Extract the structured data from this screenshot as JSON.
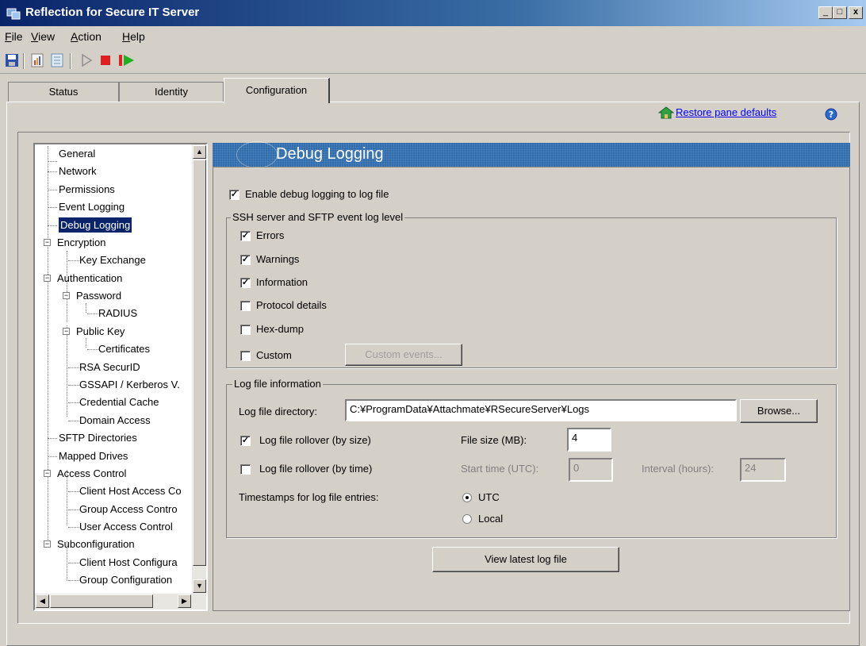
{
  "window": {
    "title": "Reflection for Secure IT Server",
    "controls": [
      "_",
      "□",
      "x"
    ]
  },
  "menu": [
    {
      "label": "File",
      "hotkey": "F",
      "rest": "ile"
    },
    {
      "label": "View",
      "hotkey": "V",
      "rest": "iew"
    },
    {
      "label": "Action",
      "hotkey": "A",
      "rest": "ction"
    },
    {
      "label": "Help",
      "hotkey": "H",
      "rest": "elp"
    }
  ],
  "toolbar": {
    "icons": [
      "save-icon",
      "report-icon",
      "list-icon",
      "start-icon",
      "stop-icon",
      "restart-icon"
    ]
  },
  "tabs": [
    {
      "label": "Status"
    },
    {
      "label": "Identity"
    },
    {
      "label": "Configuration"
    }
  ],
  "restore_link": "Restore pane defaults",
  "tree": {
    "items": [
      "General",
      "Network",
      "Permissions",
      "Event Logging",
      "Debug Logging",
      "Encryption",
      "Key Exchange",
      "Authentication",
      "Password",
      "RADIUS",
      "Public Key",
      "Certificates",
      "RSA SecurID",
      "GSSAPI / Kerberos V.",
      "Credential Cache",
      "Domain Access",
      "SFTP Directories",
      "Mapped Drives",
      "Access Control",
      "Client Host Access Co",
      "Group Access Contro",
      "User Access Control",
      "Subconfiguration",
      "Client Host Configura",
      "Group Configuration"
    ],
    "selected": "Debug Logging"
  },
  "pane": {
    "title": "Debug Logging",
    "enable_label": "Enable debug logging to log file",
    "enable_checked": true,
    "level_group": "SSH server and SFTP event log level",
    "levels": [
      {
        "label": "Errors",
        "checked": true
      },
      {
        "label": "Warnings",
        "checked": true
      },
      {
        "label": "Information",
        "checked": true
      },
      {
        "label": "Protocol details",
        "checked": false
      },
      {
        "label": "Hex-dump",
        "checked": false
      },
      {
        "label": "Custom",
        "checked": false
      }
    ],
    "custom_events_button": "Custom events...",
    "logfile_group": "Log file information",
    "log_dir_label": "Log file directory:",
    "log_dir_value": "C:¥ProgramData¥Attachmate¥RSecureServer¥Logs",
    "browse_button": "Browse...",
    "rollover_size_label": "Log file rollover (by size)",
    "rollover_size_checked": true,
    "file_size_label": "File size (MB):",
    "file_size_value": "4",
    "rollover_time_label": "Log file rollover (by time)",
    "rollover_time_checked": false,
    "start_time_label": "Start time (UTC):",
    "start_time_value": "0",
    "interval_label": "Interval (hours):",
    "interval_value": "24",
    "timestamps_label": "Timestamps for log file entries:",
    "timestamp_options": [
      {
        "label": "UTC",
        "selected": true
      },
      {
        "label": "Local",
        "selected": false
      }
    ],
    "view_log_button": "View latest log file"
  },
  "colors": {
    "accent": "#0a246a",
    "header": "#2f6cab",
    "link": "#0000ff",
    "stop": "#e02020",
    "start": "#20b020"
  }
}
